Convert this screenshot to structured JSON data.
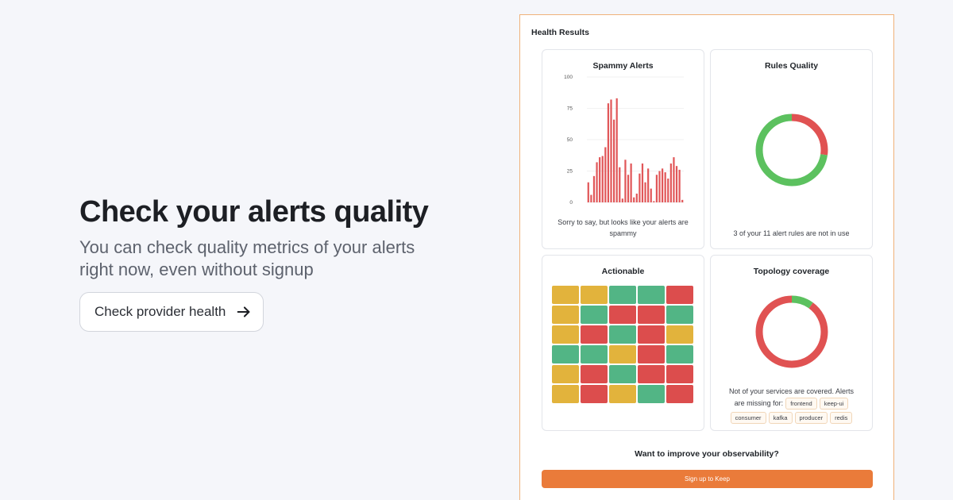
{
  "hero": {
    "heading": "Check your alerts quality",
    "subtext": "You can check quality metrics of your alerts right now, even without signup",
    "cta_label": "Check provider health",
    "cta_icon": "arrow-right-icon"
  },
  "panel": {
    "title": "Health Results",
    "improve_text": "Want to improve your observability?",
    "signup_label": "Sign up to Keep",
    "accent_color": "#ea7b3a"
  },
  "spammy": {
    "title": "Spammy Alerts",
    "caption": "Sorry to say, but looks like your alerts are spammy"
  },
  "rules": {
    "title": "Rules Quality",
    "caption": "3 of your 11 alert rules are not in use"
  },
  "actionable": {
    "title": "Actionable"
  },
  "topology": {
    "title": "Topology coverage",
    "caption_line1": "Not of your services are covered. Alerts",
    "caption_line2": "are missing for:",
    "tags": [
      "frontend",
      "keep-ui",
      "consumer",
      "kafka",
      "producer",
      "redis"
    ]
  },
  "chart_data": [
    {
      "type": "bar",
      "title": "Spammy Alerts",
      "color": "#e15759",
      "ylim": [
        0,
        100
      ],
      "yticks": [
        0,
        25,
        50,
        75,
        100
      ],
      "values": [
        16,
        6,
        21,
        32,
        36,
        37,
        44,
        79,
        82,
        66,
        83,
        28,
        3,
        34,
        22,
        31,
        4,
        7,
        23,
        31,
        16,
        27,
        11,
        1,
        22,
        25,
        27,
        24,
        19,
        31,
        36,
        29,
        26,
        2
      ],
      "grid": true
    },
    {
      "type": "pie",
      "title": "Rules Quality",
      "donut": true,
      "slices": [
        {
          "label": "not in use",
          "value": 3,
          "color": "#e05252"
        },
        {
          "label": "in use",
          "value": 8,
          "color": "#5cc15f"
        }
      ]
    },
    {
      "type": "heatmap",
      "title": "Actionable",
      "palette": {
        "Y": "#e2b33c",
        "G": "#52b585",
        "R": "#dc4d4d"
      },
      "rows": [
        [
          "Y",
          "Y",
          "G",
          "G",
          "R"
        ],
        [
          "Y",
          "G",
          "R",
          "R",
          "G"
        ],
        [
          "Y",
          "R",
          "G",
          "R",
          "Y"
        ],
        [
          "G",
          "G",
          "Y",
          "R",
          "G"
        ],
        [
          "Y",
          "R",
          "G",
          "R",
          "R"
        ],
        [
          "Y",
          "R",
          "Y",
          "G",
          "R"
        ]
      ]
    },
    {
      "type": "pie",
      "title": "Topology coverage",
      "donut": true,
      "slices": [
        {
          "label": "covered",
          "value": 10,
          "color": "#5cc15f"
        },
        {
          "label": "not covered",
          "value": 90,
          "color": "#e05252"
        }
      ]
    }
  ]
}
